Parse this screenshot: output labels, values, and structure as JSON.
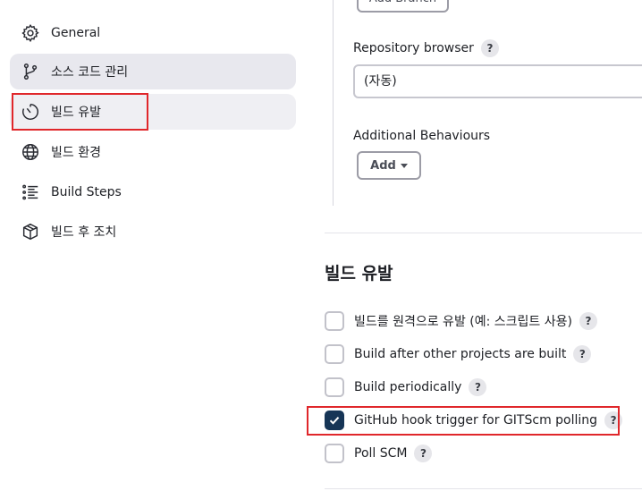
{
  "sidebar": {
    "items": [
      {
        "label": "General",
        "icon": "gear-icon"
      },
      {
        "label": "소스 코드 관리",
        "icon": "branch-icon"
      },
      {
        "label": "빌드 유발",
        "icon": "timer-icon"
      },
      {
        "label": "빌드 환경",
        "icon": "globe-icon"
      },
      {
        "label": "Build Steps",
        "icon": "list-icon"
      },
      {
        "label": "빌드 후 조치",
        "icon": "package-icon"
      }
    ]
  },
  "scm": {
    "add_branch_label": "Add Branch",
    "repository_browser_label": "Repository browser",
    "repository_browser_value": "(자동)",
    "additional_behaviours_label": "Additional Behaviours",
    "add_label": "Add"
  },
  "triggers": {
    "title": "빌드 유발",
    "help_symbol": "?",
    "options": [
      {
        "label": "빌드를 원격으로 유발 (예: 스크립트 사용)",
        "checked": false
      },
      {
        "label": "Build after other projects are built",
        "checked": false
      },
      {
        "label": "Build periodically",
        "checked": false
      },
      {
        "label": "GitHub hook trigger for GITScm polling",
        "checked": true
      },
      {
        "label": "Poll SCM",
        "checked": false
      }
    ]
  },
  "colors": {
    "highlight": "#e0272b",
    "checkbox_checked": "#163556",
    "active_nav": "#e8e8ee"
  }
}
